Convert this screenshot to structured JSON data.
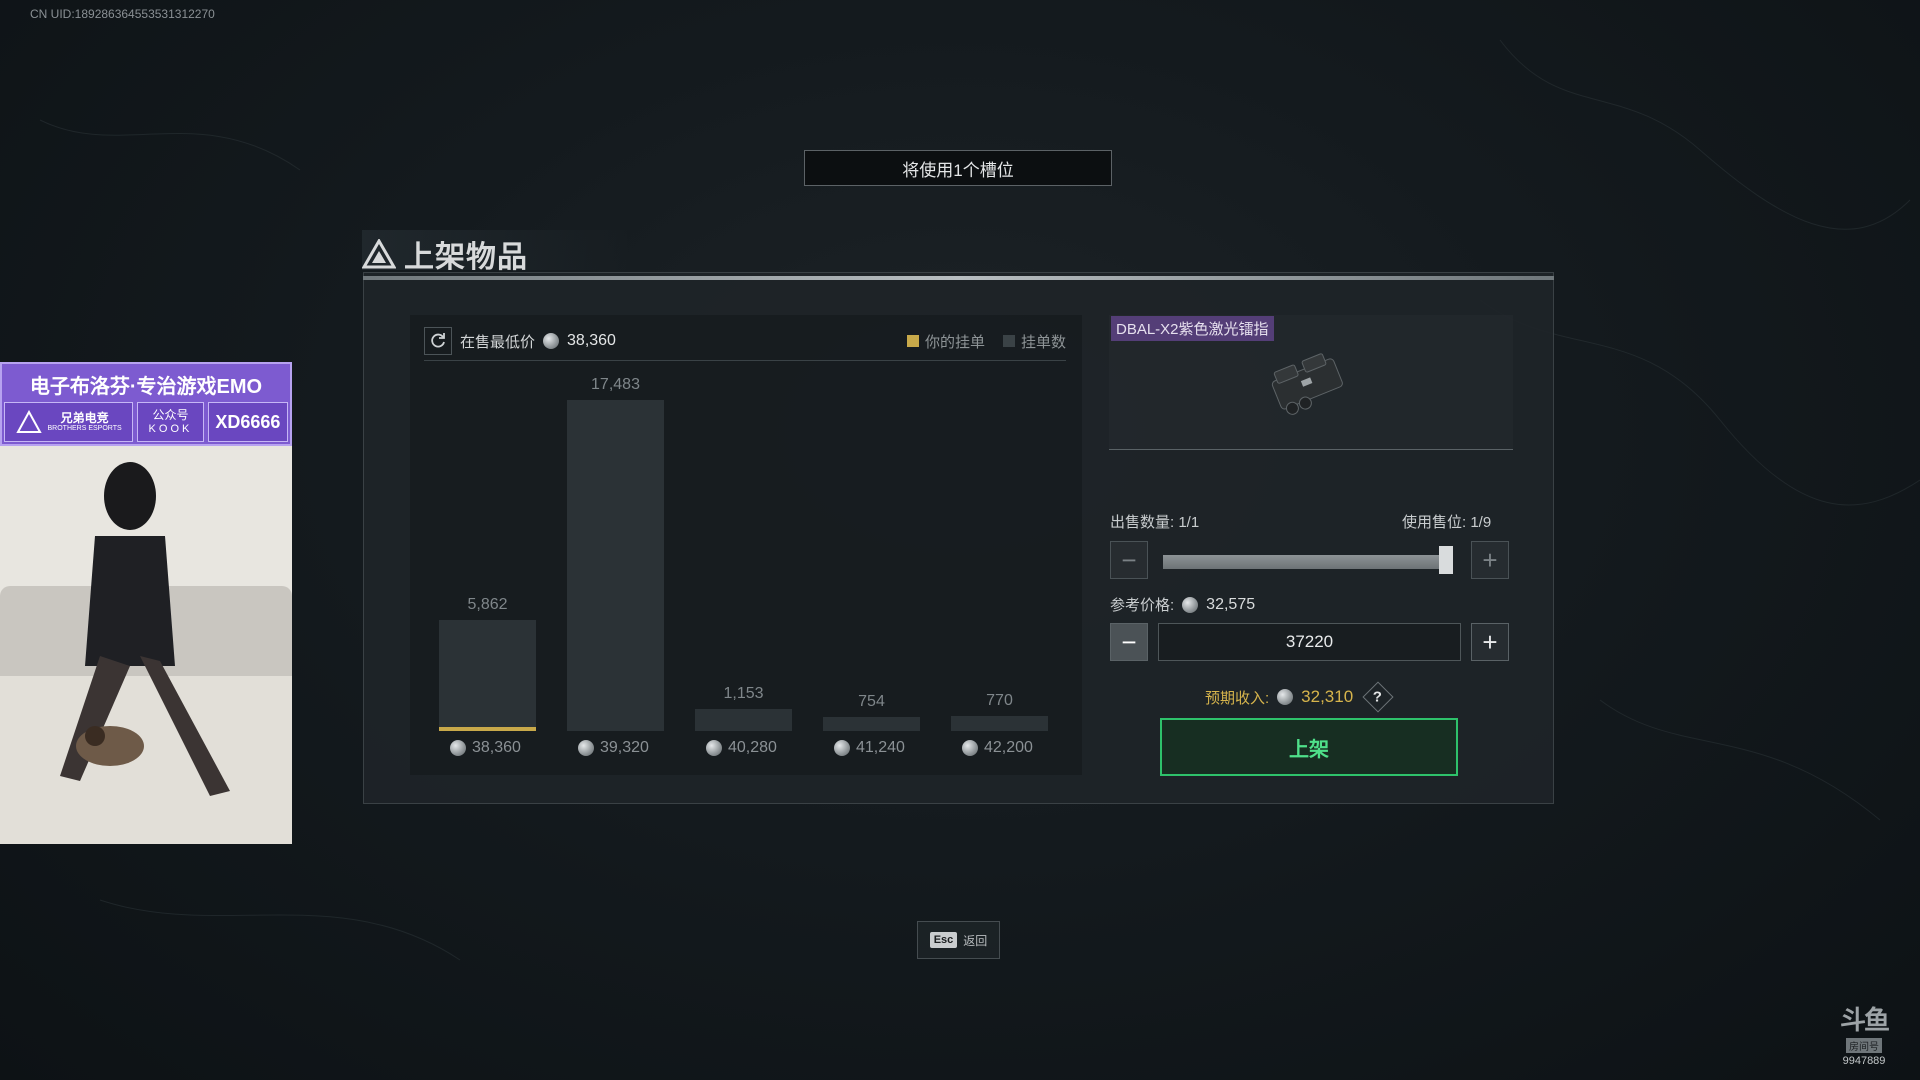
{
  "overlay": {
    "uid": "CN UID:189286364553531312270"
  },
  "banner": {
    "slot_text": "将使用1个槽位"
  },
  "dialog": {
    "title": "上架物品"
  },
  "chart_header": {
    "lowest_label": "在售最低价",
    "lowest_price": "38,360",
    "legend_yours": "你的挂单",
    "legend_count": "挂单数"
  },
  "chart_data": {
    "type": "bar",
    "categories": [
      "38,360",
      "39,320",
      "40,280",
      "41,240",
      "42,200"
    ],
    "values": [
      5862,
      17483,
      1153,
      754,
      770
    ],
    "value_labels": [
      "5,862",
      "17,483",
      "1,153",
      "754",
      "770"
    ],
    "highlight_index": 0,
    "ylim": [
      0,
      17483
    ]
  },
  "item": {
    "name": "DBAL-X2紫色激光镭指"
  },
  "sell": {
    "qty_label": "出售数量: 1/1",
    "slot_label": "使用售位: 1/9",
    "ref_label": "参考价格:",
    "ref_price": "32,575",
    "price_value": "37220",
    "expect_label": "预期收入:",
    "expect_value": "32,310",
    "help": "?",
    "list_button": "上架",
    "minus": "−",
    "plus": "+",
    "slider_fraction": 1.0
  },
  "footer": {
    "esc_key": "Esc",
    "esc_label": "返回"
  },
  "stream": {
    "banner_title": "电子布洛芬·专治游戏EMO",
    "team": "兄弟电竞",
    "team_en": "BROTHERS ESPORTS",
    "account": "公众号",
    "kook": "KOOK",
    "code": "XD6666"
  },
  "watermark": {
    "logo": "斗鱼",
    "tag": "房间号",
    "room": "9947889"
  },
  "colors": {
    "accent_green": "#2ec26b",
    "gold": "#c8a94a",
    "item_purple": "#704ca0"
  }
}
